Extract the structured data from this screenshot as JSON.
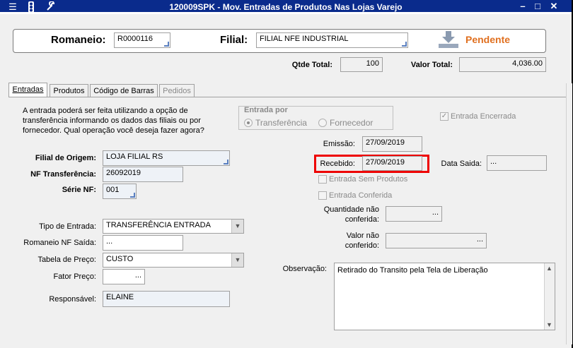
{
  "window": {
    "title": "120009SPK - Mov. Entradas de Produtos Nas Lojas Varejo"
  },
  "header": {
    "romaneio_label": "Romaneio:",
    "romaneio_value": "R0000116",
    "filial_label": "Filial:",
    "filial_value": "FILIAL NFE INDUSTRIAL",
    "status": "Pendente",
    "status_color": "#e07020"
  },
  "totals": {
    "qtde_label": "Qtde Total:",
    "qtde_value": "100",
    "valor_label": "Valor Total:",
    "valor_value": "4,036.00"
  },
  "tabs": [
    {
      "label": "Entradas",
      "active": true
    },
    {
      "label": "Produtos",
      "active": false
    },
    {
      "label": "Código de Barras",
      "active": false
    },
    {
      "label": "Pedidos",
      "active": false,
      "disabled": true
    }
  ],
  "entradas": {
    "info_text": "A entrada poderá ser feita utilizando a opção de transferência informando os dados das filiais ou por fornecedor. Qual operação você deseja fazer agora?",
    "entrada_por": {
      "title": "Entrada por",
      "opt_transferencia": "Transferência",
      "opt_fornecedor": "Fornecedor"
    },
    "entrada_encerrada": "Entrada Encerrada",
    "filial_origem_label": "Filial de Origem:",
    "filial_origem_value": "LOJA FILIAL RS",
    "nf_transf_label": "NF Transferência:",
    "nf_transf_value": "26092019",
    "serie_label": "Série NF:",
    "serie_value": "001",
    "emissao_label": "Emissão:",
    "emissao_value": "27/09/2019",
    "recebido_label": "Recebido:",
    "recebido_value": "27/09/2019",
    "data_saida_label": "Data Saida:",
    "data_saida_value": "...",
    "entrada_sem_produtos": "Entrada Sem Produtos",
    "entrada_conferida": "Entrada Conferida",
    "qtd_nao_conf_label1": "Quantidade não",
    "qtd_nao_conf_label2": "conferida:",
    "qtd_nao_conf_value": "...",
    "valor_nao_conf_label1": "Valor não",
    "valor_nao_conf_label2": "conferido:",
    "valor_nao_conf_value": "...",
    "tipo_entrada_label": "Tipo de Entrada:",
    "tipo_entrada_value": "TRANSFERÊNCIA ENTRADA",
    "romaneio_nf_saida_label": "Romaneio NF Saída:",
    "romaneio_nf_saida_value": "...",
    "tabela_preco_label": "Tabela de Preço:",
    "tabela_preco_value": "CUSTO",
    "fator_preco_label": "Fator Preço:",
    "fator_preco_value": "...",
    "responsavel_label": "Responsável:",
    "responsavel_value": "ELAINE",
    "observacao_label": "Observação:",
    "observacao_value": "Retirado do Transito pela Tela de Liberação"
  }
}
